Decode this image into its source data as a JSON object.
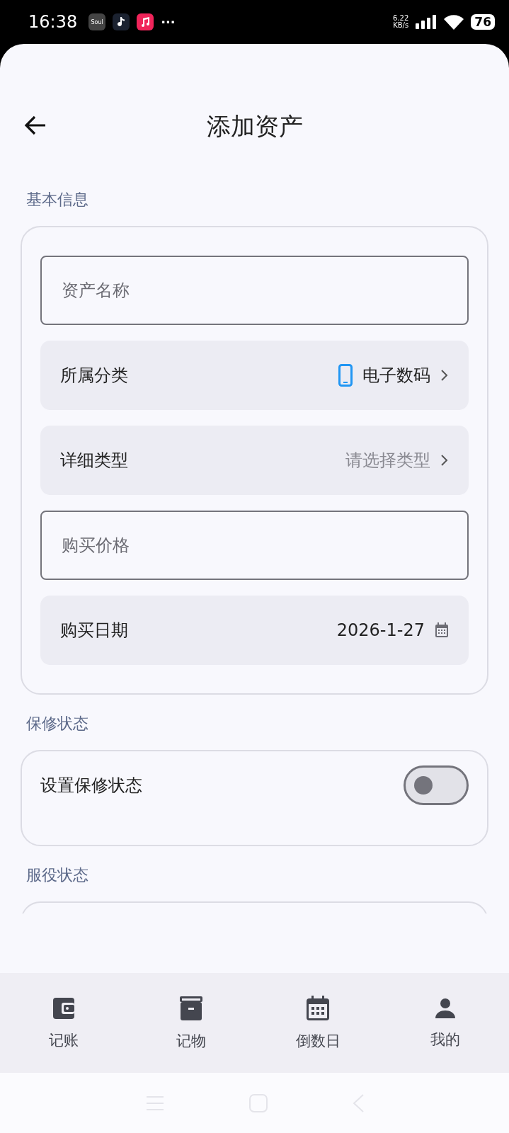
{
  "status_bar": {
    "time": "16:38",
    "apps": [
      {
        "kind": "soul",
        "label": "Soul"
      },
      {
        "kind": "note"
      },
      {
        "kind": "music"
      }
    ],
    "more": "···",
    "net_speed": "6.22",
    "net_unit": "KB/s",
    "battery": "76"
  },
  "header": {
    "title": "添加资产"
  },
  "sections": [
    {
      "title": "基本信息",
      "rows": [
        {
          "kind": "input",
          "placeholder": "资产名称"
        },
        {
          "kind": "category",
          "label": "所属分类",
          "value": "电子数码"
        },
        {
          "kind": "select",
          "label": "详细类型",
          "placeholder": "请选择类型"
        },
        {
          "kind": "input",
          "placeholder": "购买价格"
        },
        {
          "kind": "date",
          "label": "购买日期",
          "value": "2026-1-27"
        }
      ]
    },
    {
      "title": "保修状态",
      "rows": [
        {
          "kind": "switch",
          "label": "设置保修状态",
          "on": false
        }
      ]
    },
    {
      "title": "服役状态"
    }
  ],
  "nav": [
    {
      "label": "记账"
    },
    {
      "label": "记物"
    },
    {
      "label": "倒数日"
    },
    {
      "label": "我的"
    }
  ]
}
